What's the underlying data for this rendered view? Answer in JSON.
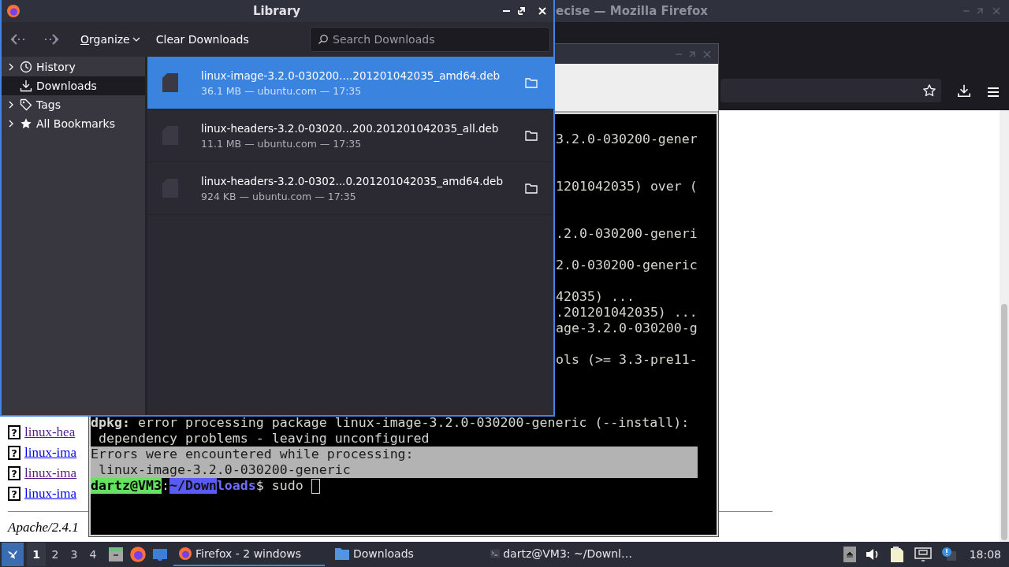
{
  "browser_window": {
    "title": "ecise — Mozilla Firefox"
  },
  "page": {
    "links": [
      {
        "icon": "?",
        "text": "linux-hea",
        "visited": true
      },
      {
        "icon": "?",
        "text": "linux-ima",
        "visited": false
      },
      {
        "icon": "?",
        "text": "linux-ima",
        "visited": true
      },
      {
        "icon": "?",
        "text": "linux-ima",
        "visited": false
      }
    ],
    "footer": "Apache/2.4.1"
  },
  "terminal": {
    "partial_lines": [
      "3.2.0-030200-gener",
      "1201042035) over (",
      ".2.0-030200-generi",
      "2.0-030200-generic",
      "42035) ...",
      ".201201042035) ...",
      "age-3.2.0-030200-g",
      "ols (>= 3.3-pre11-"
    ],
    "lines": [
      {
        "text": "**dpkg:** error processing package linux-image-3.2.0-030200-generic (--install):",
        "selected": false
      },
      {
        "text": " dependency problems - leaving unconfigured",
        "selected": false
      },
      {
        "text": "Errors were encountered while processing:",
        "selected": true
      },
      {
        "text": " linux-image-3.2.0-030200-generic",
        "selected": true
      }
    ],
    "prompt": {
      "user": "dartz@VM3",
      "separator": ":",
      "path": [
        {
          "text": "~/Down",
          "selected": true
        },
        {
          "text": "loads",
          "selected": false
        }
      ],
      "symbol": "$",
      "command": "sudo"
    }
  },
  "library": {
    "title": "Library",
    "organize": "Organize",
    "clear": "Clear Downloads",
    "search": {
      "placeholder": "Search Downloads"
    },
    "sidebar": [
      {
        "kind": "history",
        "label": "History",
        "expandable": true,
        "selected": false
      },
      {
        "kind": "downloads",
        "label": "Downloads",
        "expandable": false,
        "selected": true
      },
      {
        "kind": "tags",
        "label": "Tags",
        "expandable": true,
        "selected": false
      },
      {
        "kind": "bookmarks",
        "label": "All Bookmarks",
        "expandable": true,
        "selected": false
      }
    ],
    "downloads": [
      {
        "name": "linux-image-3.2.0-030200....201201042035_amd64.deb",
        "status": "36.1 MB — ubuntu.com — 17:35",
        "selected": true
      },
      {
        "name": "linux-headers-3.2.0-03020...200.201201042035_all.deb",
        "status": "11.1 MB — ubuntu.com — 17:35",
        "selected": false
      },
      {
        "name": "linux-headers-3.2.0-0302...0.201201042035_amd64.deb",
        "status": "924 KB — ubuntu.com — 17:35",
        "selected": false
      }
    ]
  },
  "taskbar": {
    "workspaces": [
      {
        "label": "1",
        "selected": true
      },
      {
        "label": "2",
        "selected": false
      },
      {
        "label": "3",
        "selected": false
      },
      {
        "label": "4",
        "selected": false
      }
    ],
    "tasks": [
      {
        "kind": "browser",
        "label": "Firefox - 2 windows",
        "selected": true
      },
      {
        "kind": "folder",
        "label": "Downloads",
        "selected": false
      },
      {
        "kind": "terminal",
        "label": "dartz@VM3: ~/Downl…",
        "selected": false
      }
    ],
    "clock": "18:08"
  }
}
